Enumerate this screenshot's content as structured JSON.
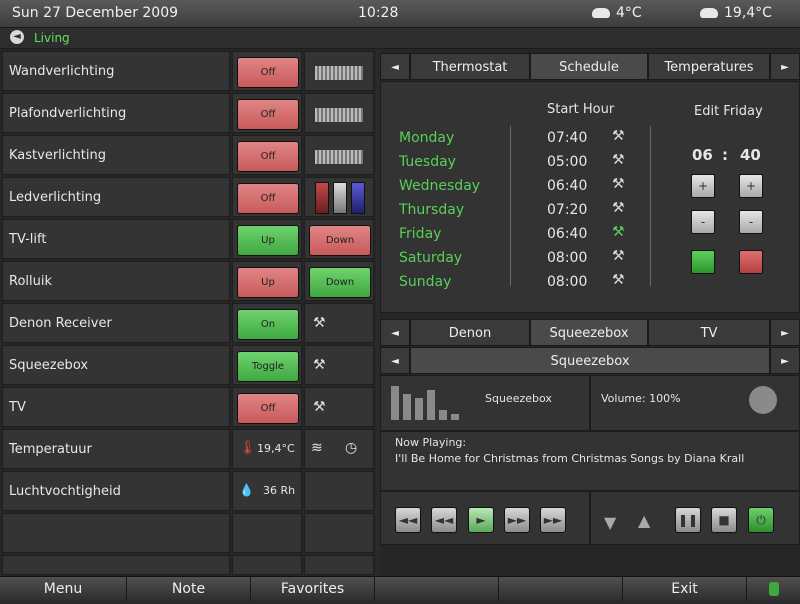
{
  "topbar": {
    "date": "Sun 27 December 2009",
    "time": "10:28",
    "weather_outside": "4°C",
    "weather_inside": "19,4°C"
  },
  "breadcrumb": {
    "label": "Living"
  },
  "devices": [
    {
      "name": "Wandverlichting",
      "button": "Off",
      "color": "red",
      "extra": "slider"
    },
    {
      "name": "Plafondverlichting",
      "button": "Off",
      "color": "red",
      "extra": "slider"
    },
    {
      "name": "Kastverlichting",
      "button": "Off",
      "color": "red",
      "extra": "slider"
    },
    {
      "name": "Ledverlichting",
      "button": "Off",
      "color": "red",
      "extra": "rgb"
    },
    {
      "name": "TV-lift",
      "button": "Up",
      "color": "green",
      "button2": "Down",
      "color2": "red"
    },
    {
      "name": "Rolluik",
      "button": "Up",
      "color": "red",
      "button2": "Down",
      "color2": "green"
    },
    {
      "name": "Denon Receiver",
      "button": "On",
      "color": "green",
      "extra": "tools"
    },
    {
      "name": "Squeezebox",
      "button": "Toggle",
      "color": "green",
      "extra": "tools"
    },
    {
      "name": "TV",
      "button": "Off",
      "color": "red",
      "extra": "tools"
    }
  ],
  "temperature": {
    "label": "Temperatuur",
    "value": "19,4°C"
  },
  "humidity": {
    "label": "Luchtvochtigheid",
    "value": "36 Rh"
  },
  "schedule_tabs": [
    "Thermostat",
    "Schedule",
    "Temperatures"
  ],
  "schedule": {
    "start_hour_label": "Start Hour",
    "edit_label": "Edit Friday",
    "days": [
      {
        "day": "Monday",
        "time": "07:40"
      },
      {
        "day": "Tuesday",
        "time": "05:00"
      },
      {
        "day": "Wednesday",
        "time": "06:40"
      },
      {
        "day": "Thursday",
        "time": "07:20"
      },
      {
        "day": "Friday",
        "time": "06:40"
      },
      {
        "day": "Saturday",
        "time": "08:00"
      },
      {
        "day": "Sunday",
        "time": "08:00"
      }
    ],
    "edit_hour": "06",
    "edit_min": "40"
  },
  "media_tabs": [
    "Denon",
    "Squeezebox",
    "TV"
  ],
  "media": {
    "subtitle": "Squeezebox",
    "device": "Squeezebox",
    "volume": "Volume: 100%",
    "now_playing_label": "Now Playing:",
    "now_playing": "I'll Be Home for Christmas from Christmas Songs by Diana Krall"
  },
  "bottombar": {
    "menu": "Menu",
    "note": "Note",
    "favorites": "Favorites",
    "exit": "Exit"
  }
}
